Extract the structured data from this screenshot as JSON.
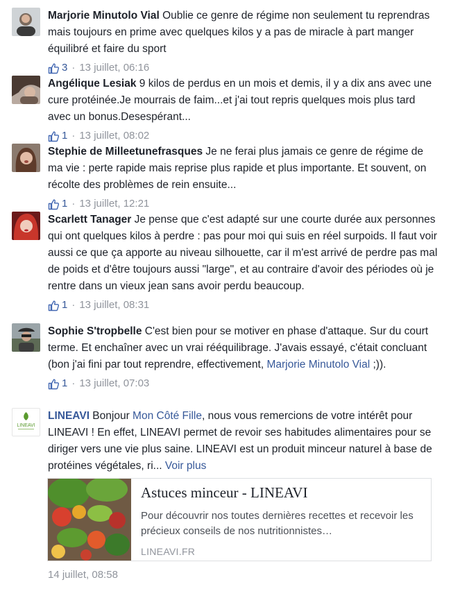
{
  "comments": [
    {
      "author": "Marjorie Minutolo Vial",
      "text": " Oublie ce genre de régime non seulement tu reprendras mais toujours en prime avec quelques kilos y a pas de miracle à part manger équilibré et faire du sport",
      "likes": "3",
      "separator": "·",
      "time": "13 juillet, 06:16"
    },
    {
      "author": "Angélique Lesiak",
      "text": " 9 kilos de perdus en un mois et demis, il y a dix ans avec une cure protéinée.Je mourrais de faim...et j'ai tout repris quelques mois plus tard avec un bonus.Desespérant...",
      "likes": "1",
      "separator": "·",
      "time": "13 juillet, 08:02"
    },
    {
      "author": "Stephie de Milleetunefrasques",
      "text": " Je ne ferai plus jamais ce genre de régime de ma vie : perte rapide mais reprise plus rapide et plus importante. Et souvent, on récolte des problèmes de rein ensuite...",
      "likes": "1",
      "separator": "·",
      "time": "13 juillet, 12:21"
    },
    {
      "author": "Scarlett Tanager",
      "text": " Je pense que c'est adapté sur une courte durée aux personnes qui ont quelques kilos à perdre : pas pour moi qui suis en réel surpoids. Il faut voir aussi ce que ça apporte au niveau silhouette, car il m'est arrivé de perdre pas mal de poids et d'être toujours aussi \"large\", et au contraire d'avoir des périodes où je rentre dans un vieux jean sans avoir perdu beaucoup.",
      "likes": "1",
      "separator": "·",
      "time": "13 juillet, 08:31"
    },
    {
      "author": "Sophie S'tropbelle",
      "text_before": " C'est bien pour se motiver en phase d'attaque. Sur du court terme. Et enchaîner avec un vrai rééquilibrage. J'avais essayé, c'était concluant (bon j'ai fini par tout reprendre, effectivement, ",
      "mention": "Marjorie Minutolo Vial",
      "text_after": " ;)).",
      "likes": "1",
      "separator": "·",
      "time": "13 juillet, 07:03"
    }
  ],
  "brand_reply": {
    "author": "LINEAVI",
    "logo_text": "LINEAVI",
    "greeting": " Bonjour ",
    "mention": "Mon Côté Fille",
    "text": ", nous vous remercions de votre intérêt pour LINEAVI ! En effet, LINEAVI permet de revoir ses habitudes alimentaires pour se diriger vers une vie plus saine. LINEAVI est un produit minceur naturel à base de protéines végétales, ri... ",
    "see_more": "Voir plus",
    "card": {
      "title": "Astuces minceur - LINEAVI",
      "description": "Pour découvrir nos toutes dernières recettes et recevoir les précieux conseils de nos nutritionnistes…",
      "domain": "LINEAVI.FR"
    },
    "time": "14 juillet, 08:58"
  },
  "colors": {
    "link": "#365899",
    "meta": "#90949c",
    "text": "#1d2129",
    "like_icon": "#4267b2",
    "logo_green": "#5a9a2e"
  }
}
